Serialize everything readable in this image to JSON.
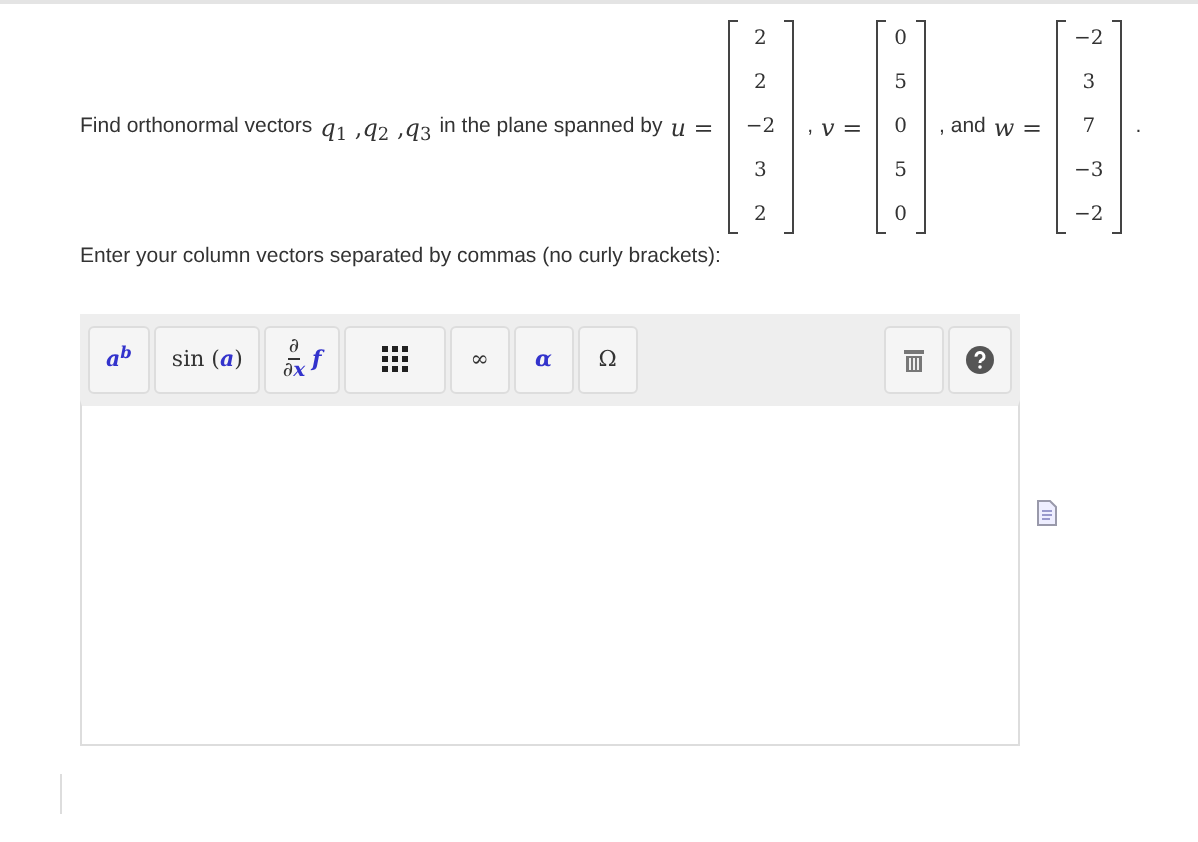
{
  "problem": [
    {
      "kind": "text",
      "text": "Find orthonormal vectors"
    },
    {
      "kind": "math",
      "text": "*q*$_{1}$ ,*q*$_{2}$ ,*q*$_{3}$"
    },
    {
      "kind": "text",
      "text": "in the plane spanned by"
    },
    {
      "kind": "math",
      "text": "*u* ="
    },
    {
      "kind": "matrix",
      "entries": [
        "2",
        "2",
        "−2",
        "3",
        "2"
      ]
    },
    {
      "kind": "text",
      "text": ","
    },
    {
      "kind": "math",
      "text": "*v* ="
    },
    {
      "kind": "matrix",
      "entries": [
        "0",
        "5",
        "0",
        "5",
        "0"
      ]
    },
    {
      "kind": "text",
      "text": ", and"
    },
    {
      "kind": "math",
      "text": "*w* ="
    },
    {
      "kind": "matrix",
      "entries": [
        "−2",
        "3",
        "7",
        "−3",
        "−2"
      ]
    },
    {
      "kind": "text",
      "text": "."
    }
  ],
  "instruction": "Enter your column vectors separated by commas (no curly brackets):",
  "toolbar": [
    {
      "kind": "rich",
      "label": "*a*$^{b}$"
    },
    {
      "kind": "rich",
      "label": "sin (*a*)"
    },
    {
      "kind": "fraction",
      "numerator": "∂",
      "denominator": "∂*x*",
      "after": "*f*"
    },
    {
      "kind": "matrix-icon"
    },
    {
      "kind": "rich",
      "label": "∞"
    },
    {
      "kind": "rich",
      "label": "*α*"
    },
    {
      "kind": "rich",
      "label": "Ω"
    },
    {
      "kind": "trash"
    },
    {
      "kind": "help"
    }
  ]
}
